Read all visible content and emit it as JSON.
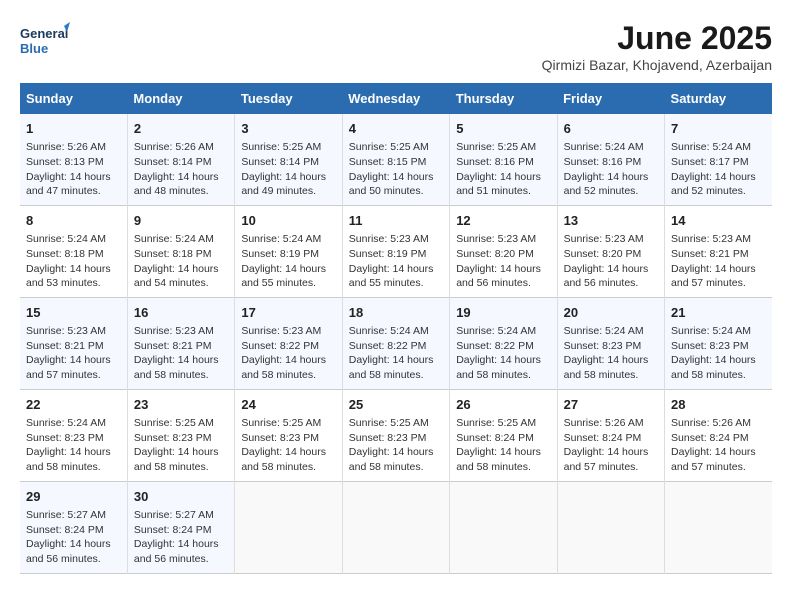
{
  "logo": {
    "line1": "General",
    "line2": "Blue"
  },
  "title": "June 2025",
  "location": "Qirmizi Bazar, Khojavend, Azerbaijan",
  "weekdays": [
    "Sunday",
    "Monday",
    "Tuesday",
    "Wednesday",
    "Thursday",
    "Friday",
    "Saturday"
  ],
  "weeks": [
    [
      {
        "day": "1",
        "info": "Sunrise: 5:26 AM\nSunset: 8:13 PM\nDaylight: 14 hours\nand 47 minutes."
      },
      {
        "day": "2",
        "info": "Sunrise: 5:26 AM\nSunset: 8:14 PM\nDaylight: 14 hours\nand 48 minutes."
      },
      {
        "day": "3",
        "info": "Sunrise: 5:25 AM\nSunset: 8:14 PM\nDaylight: 14 hours\nand 49 minutes."
      },
      {
        "day": "4",
        "info": "Sunrise: 5:25 AM\nSunset: 8:15 PM\nDaylight: 14 hours\nand 50 minutes."
      },
      {
        "day": "5",
        "info": "Sunrise: 5:25 AM\nSunset: 8:16 PM\nDaylight: 14 hours\nand 51 minutes."
      },
      {
        "day": "6",
        "info": "Sunrise: 5:24 AM\nSunset: 8:16 PM\nDaylight: 14 hours\nand 52 minutes."
      },
      {
        "day": "7",
        "info": "Sunrise: 5:24 AM\nSunset: 8:17 PM\nDaylight: 14 hours\nand 52 minutes."
      }
    ],
    [
      {
        "day": "8",
        "info": "Sunrise: 5:24 AM\nSunset: 8:18 PM\nDaylight: 14 hours\nand 53 minutes."
      },
      {
        "day": "9",
        "info": "Sunrise: 5:24 AM\nSunset: 8:18 PM\nDaylight: 14 hours\nand 54 minutes."
      },
      {
        "day": "10",
        "info": "Sunrise: 5:24 AM\nSunset: 8:19 PM\nDaylight: 14 hours\nand 55 minutes."
      },
      {
        "day": "11",
        "info": "Sunrise: 5:23 AM\nSunset: 8:19 PM\nDaylight: 14 hours\nand 55 minutes."
      },
      {
        "day": "12",
        "info": "Sunrise: 5:23 AM\nSunset: 8:20 PM\nDaylight: 14 hours\nand 56 minutes."
      },
      {
        "day": "13",
        "info": "Sunrise: 5:23 AM\nSunset: 8:20 PM\nDaylight: 14 hours\nand 56 minutes."
      },
      {
        "day": "14",
        "info": "Sunrise: 5:23 AM\nSunset: 8:21 PM\nDaylight: 14 hours\nand 57 minutes."
      }
    ],
    [
      {
        "day": "15",
        "info": "Sunrise: 5:23 AM\nSunset: 8:21 PM\nDaylight: 14 hours\nand 57 minutes."
      },
      {
        "day": "16",
        "info": "Sunrise: 5:23 AM\nSunset: 8:21 PM\nDaylight: 14 hours\nand 58 minutes."
      },
      {
        "day": "17",
        "info": "Sunrise: 5:23 AM\nSunset: 8:22 PM\nDaylight: 14 hours\nand 58 minutes."
      },
      {
        "day": "18",
        "info": "Sunrise: 5:24 AM\nSunset: 8:22 PM\nDaylight: 14 hours\nand 58 minutes."
      },
      {
        "day": "19",
        "info": "Sunrise: 5:24 AM\nSunset: 8:22 PM\nDaylight: 14 hours\nand 58 minutes."
      },
      {
        "day": "20",
        "info": "Sunrise: 5:24 AM\nSunset: 8:23 PM\nDaylight: 14 hours\nand 58 minutes."
      },
      {
        "day": "21",
        "info": "Sunrise: 5:24 AM\nSunset: 8:23 PM\nDaylight: 14 hours\nand 58 minutes."
      }
    ],
    [
      {
        "day": "22",
        "info": "Sunrise: 5:24 AM\nSunset: 8:23 PM\nDaylight: 14 hours\nand 58 minutes."
      },
      {
        "day": "23",
        "info": "Sunrise: 5:25 AM\nSunset: 8:23 PM\nDaylight: 14 hours\nand 58 minutes."
      },
      {
        "day": "24",
        "info": "Sunrise: 5:25 AM\nSunset: 8:23 PM\nDaylight: 14 hours\nand 58 minutes."
      },
      {
        "day": "25",
        "info": "Sunrise: 5:25 AM\nSunset: 8:23 PM\nDaylight: 14 hours\nand 58 minutes."
      },
      {
        "day": "26",
        "info": "Sunrise: 5:25 AM\nSunset: 8:24 PM\nDaylight: 14 hours\nand 58 minutes."
      },
      {
        "day": "27",
        "info": "Sunrise: 5:26 AM\nSunset: 8:24 PM\nDaylight: 14 hours\nand 57 minutes."
      },
      {
        "day": "28",
        "info": "Sunrise: 5:26 AM\nSunset: 8:24 PM\nDaylight: 14 hours\nand 57 minutes."
      }
    ],
    [
      {
        "day": "29",
        "info": "Sunrise: 5:27 AM\nSunset: 8:24 PM\nDaylight: 14 hours\nand 56 minutes."
      },
      {
        "day": "30",
        "info": "Sunrise: 5:27 AM\nSunset: 8:24 PM\nDaylight: 14 hours\nand 56 minutes."
      },
      {
        "day": "",
        "info": ""
      },
      {
        "day": "",
        "info": ""
      },
      {
        "day": "",
        "info": ""
      },
      {
        "day": "",
        "info": ""
      },
      {
        "day": "",
        "info": ""
      }
    ]
  ]
}
